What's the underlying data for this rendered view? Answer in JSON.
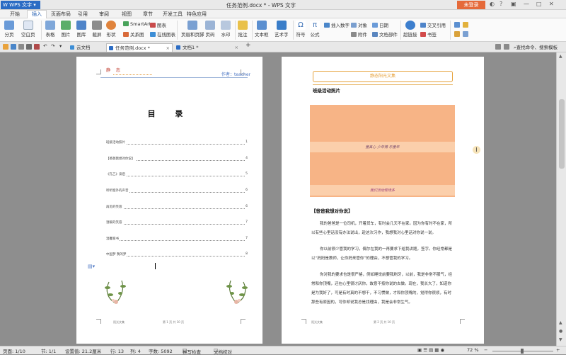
{
  "app": {
    "name": "WPS 文字",
    "window_title": "任务范例.docx * - WPS 文字",
    "login_label": "未登录",
    "window_controls": [
      "◐",
      "?",
      "▣",
      "—",
      "□",
      "✕"
    ]
  },
  "menu": [
    "开始",
    "插入",
    "页面布局",
    "引用",
    "审阅",
    "视图",
    "章节",
    "开发工具",
    "特色应用"
  ],
  "menu_active_index": 1,
  "ribbon": {
    "large": [
      "分页",
      "空白页",
      "表格",
      "图片",
      "图库",
      "截屏",
      "形状",
      "页眉和页脚",
      "页码",
      "水印",
      "批注",
      "文本框",
      "艺术字",
      "符号",
      "公式",
      "超链接"
    ],
    "small": [
      "SmartArt",
      "关系图",
      "图表",
      "在线图表",
      "插入数字",
      "对象",
      "附件",
      "日期",
      "文档部件",
      "交叉引用",
      "书签"
    ]
  },
  "tabs": {
    "items": [
      {
        "label": "云文档",
        "active": false
      },
      {
        "label": "任务范例.docx *",
        "active": true
      },
      {
        "label": "文档1 *",
        "active": false
      }
    ],
    "add": "+",
    "search_hint": "查找命令、搜索模板"
  },
  "page1": {
    "header_left": "静 态",
    "header_right": "作者：teacher",
    "toc_title": "目 录",
    "toc": [
      {
        "title": "班级活动照片",
        "page": "1"
      },
      {
        "title": "【爸爸我想对你说】",
        "page": "4"
      },
      {
        "title": "《孔乙》读后",
        "page": "5"
      },
      {
        "title": "听听窗外的声音",
        "page": "6"
      },
      {
        "title": "再见的笑容",
        "page": "6"
      },
      {
        "title": "温暖的笑容",
        "page": "7"
      },
      {
        "title": "温馨家书",
        "page": "7"
      },
      {
        "title": "中国梦 我的梦",
        "page": "8"
      }
    ],
    "footer_left": "阳光文集",
    "footer_center": "第 1 页 共 10 页"
  },
  "page2": {
    "header_box": "静态阳光文集",
    "heading": "班级活动照片",
    "photo_caption_1": "童真心  少年情  乐童年",
    "photo_caption_2": "我们活动现场多",
    "section_title": "【爸爸我想对你说】",
    "paragraphs": [
      "我的爸爸是一位司机，开着货车，有时会几天不在家。因为你有时不在家，所以有些心里话没有办法说出，趁这次习作，我想我对心里话对你说一说。",
      "你以前很少管我的学习，偶尔在我的一再要求下给我讲题，签字。你经常都是以“妈妈是教师，让你妈来管你”的理由，不想管我的学习。",
      "你对我的要求也是很严格，例如睡觉前要我刷牙，以前，我是非常不服气，经常和你顶嘴，还在心里很讨厌你，故意不按你说的去做。现在，我长大了，知道你是为我好了，可是有时真的不想干，不习惯做，才和你顶嘴的，觉得你很烦，有时那些有原因的，可你却说我总是找理由，我是会非常生气。"
    ],
    "footer_left": "阳光文集",
    "footer_center": "第 2 页 共 10 页"
  },
  "status": {
    "page": "页面: 1/10",
    "section": "节: 1/1",
    "position": "设置值: 21.2厘米",
    "row": "行: 13",
    "col": "列: 4",
    "words": "字数: 5092",
    "spell": "拼写检查",
    "proof": "文档校对",
    "zoom": "72 %"
  },
  "colors": {
    "accent": "#2b6cc4",
    "login": "#e56a3a",
    "photo": "#f7b486",
    "header_accent": "#e6a23c"
  }
}
